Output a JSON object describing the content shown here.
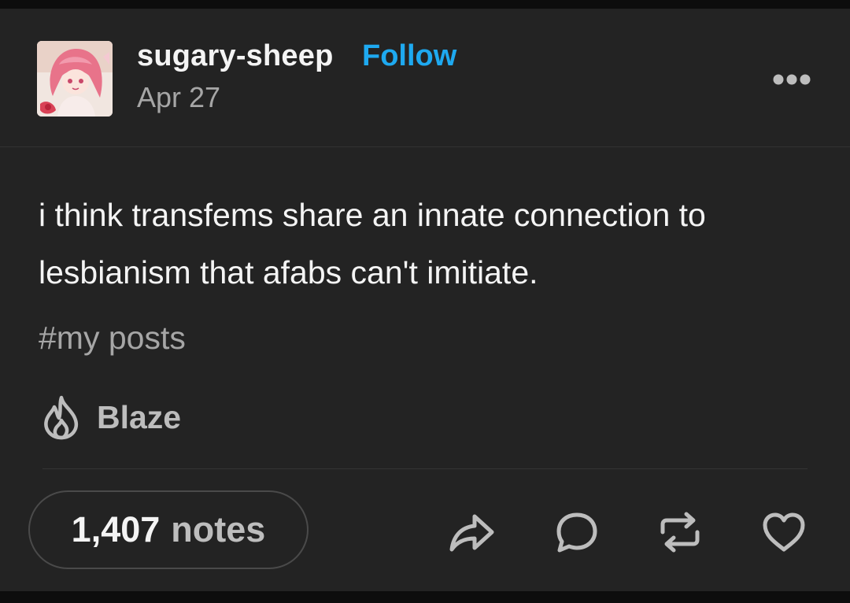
{
  "post": {
    "username": "sugary-sheep",
    "follow_label": "Follow",
    "date": "Apr 27",
    "body": "i think transfems share an innate connection to lesbianism that afabs can't imitiate.",
    "tag": "#my posts",
    "blaze_label": "Blaze",
    "notes_count": "1,407",
    "notes_label": "notes"
  },
  "icons": {
    "more": "more-options-icon",
    "blaze": "flame-icon",
    "share": "share-arrow-icon",
    "reply": "speech-bubble-icon",
    "reblog": "reblog-icon",
    "like": "heart-icon"
  },
  "colors": {
    "background": "#232323",
    "accent": "#1ea9f0",
    "primary_text": "#f4f4f4",
    "secondary_text": "#a6a6a6"
  }
}
